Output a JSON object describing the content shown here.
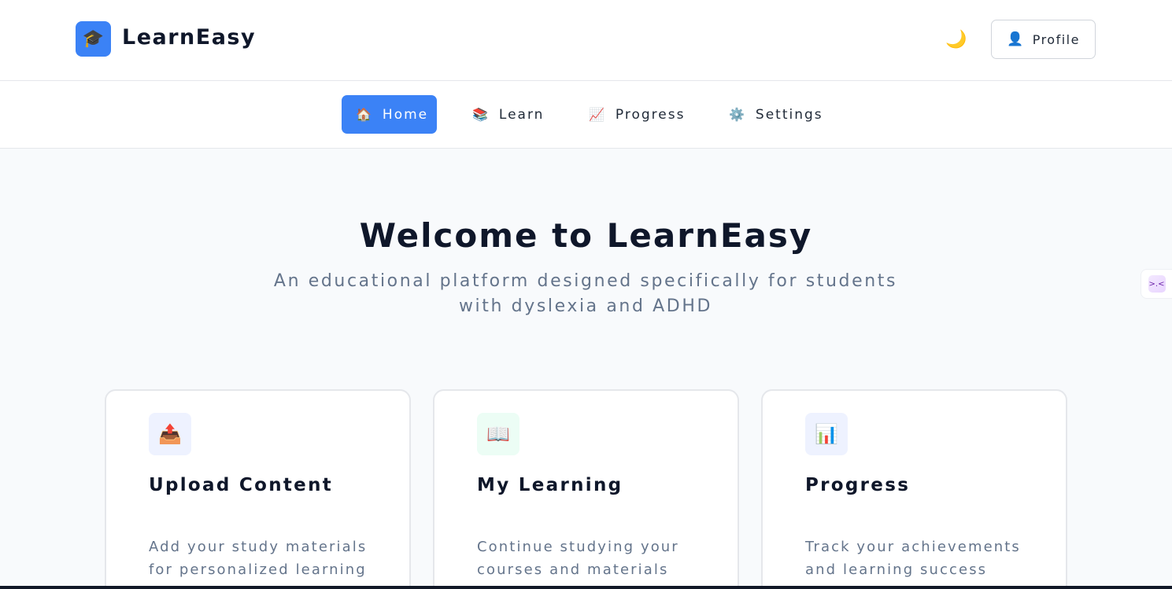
{
  "header": {
    "logo_icon": "graduation-cap-icon",
    "logo_glyph": "🎓",
    "brand": "LearnEasy",
    "theme_toggle_glyph": "🌙",
    "profile": {
      "icon": "👤",
      "label": "Profile"
    }
  },
  "nav": {
    "items": [
      {
        "icon": "🏠",
        "label": "Home",
        "active": true
      },
      {
        "icon": "📚",
        "label": "Learn",
        "active": false
      },
      {
        "icon": "📈",
        "label": "Progress",
        "active": false
      },
      {
        "icon": "⚙️",
        "label": "Settings",
        "active": false
      }
    ]
  },
  "hero": {
    "title": "Welcome to LearnEasy",
    "subtitle": "An educational platform designed specifically for students with dyslexia and ADHD"
  },
  "cards": [
    {
      "icon": "📤",
      "icon_name": "upload-icon",
      "icon_bg": "#eef2ff",
      "title": "Upload Content",
      "description": "Add your study materials for personalized learning"
    },
    {
      "icon": "📖",
      "icon_name": "open-book-icon",
      "icon_bg": "#ecfdf5",
      "title": "My Learning",
      "description": "Continue studying your courses and materials"
    },
    {
      "icon": "📊",
      "icon_name": "bar-chart-icon",
      "icon_bg": "#eef2ff",
      "title": "Progress",
      "description": "Track your achievements and learning success"
    }
  ],
  "side_tab": {
    "glyph": ">.<"
  },
  "colors": {
    "accent": "#3b82f6",
    "text": "#0f172a",
    "muted": "#64748b",
    "background": "#f8fafc"
  }
}
